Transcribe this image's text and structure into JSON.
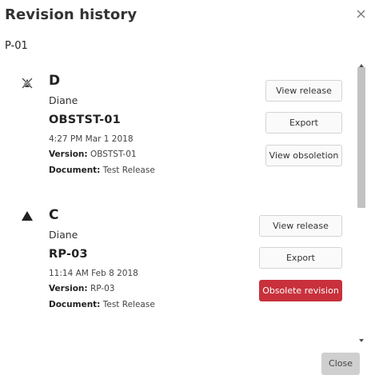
{
  "dialog": {
    "title": "Revision history",
    "part_number": "P-01",
    "close_label": "Close"
  },
  "revisions": [
    {
      "icon": "obsolete-revision-icon",
      "letter": "D",
      "user": "Diane",
      "name": "OBSTST-01",
      "timestamp": "4:27 PM Mar 1 2018",
      "version_label": "Version:",
      "version_value": "OBSTST-01",
      "document_label": "Document:",
      "document_value": "Test Release",
      "buttons": [
        "View release",
        "Export",
        "View obsoletion"
      ]
    },
    {
      "icon": "triangle-icon",
      "letter": "C",
      "user": "Diane",
      "name": "RP-03",
      "timestamp": "11:14 AM Feb 8 2018",
      "version_label": "Version:",
      "version_value": "RP-03",
      "document_label": "Document:",
      "document_value": "Test Release",
      "buttons": [
        "View release",
        "Export",
        "Obsolete revision"
      ]
    }
  ],
  "colors": {
    "danger": "#c8313b",
    "close_button": "#cfcfcf",
    "scroll_thumb": "#c2c2c2"
  }
}
